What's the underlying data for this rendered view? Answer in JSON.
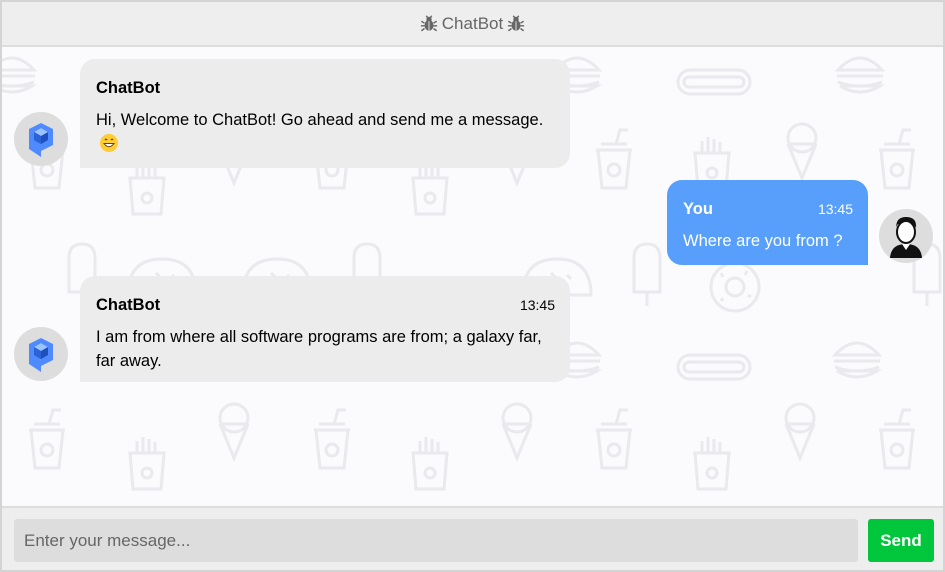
{
  "header": {
    "title": "ChatBot",
    "left_icon": "bug-icon",
    "right_icon": "bug-icon"
  },
  "messages": [
    {
      "side": "left",
      "name": "ChatBot",
      "time": "",
      "text": "Hi, Welcome to ChatBot! Go ahead and send me a message.",
      "emoji": "grinning-face-emoji",
      "avatar": "bot-avatar"
    },
    {
      "side": "right",
      "name": "You",
      "time": "13:45",
      "text": "Where are you from ?",
      "avatar": "user-avatar"
    },
    {
      "side": "left",
      "name": "ChatBot",
      "time": "13:45",
      "text": "I am from where all software programs are from; a galaxy far, far away.",
      "avatar": "bot-avatar"
    }
  ],
  "composer": {
    "placeholder": "Enter your message...",
    "value": "",
    "send_label": "Send"
  },
  "colors": {
    "bot_bubble": "#ececec",
    "user_bubble": "#579ffb",
    "send_button": "#00c63b",
    "header_bg": "#eeeeee"
  }
}
